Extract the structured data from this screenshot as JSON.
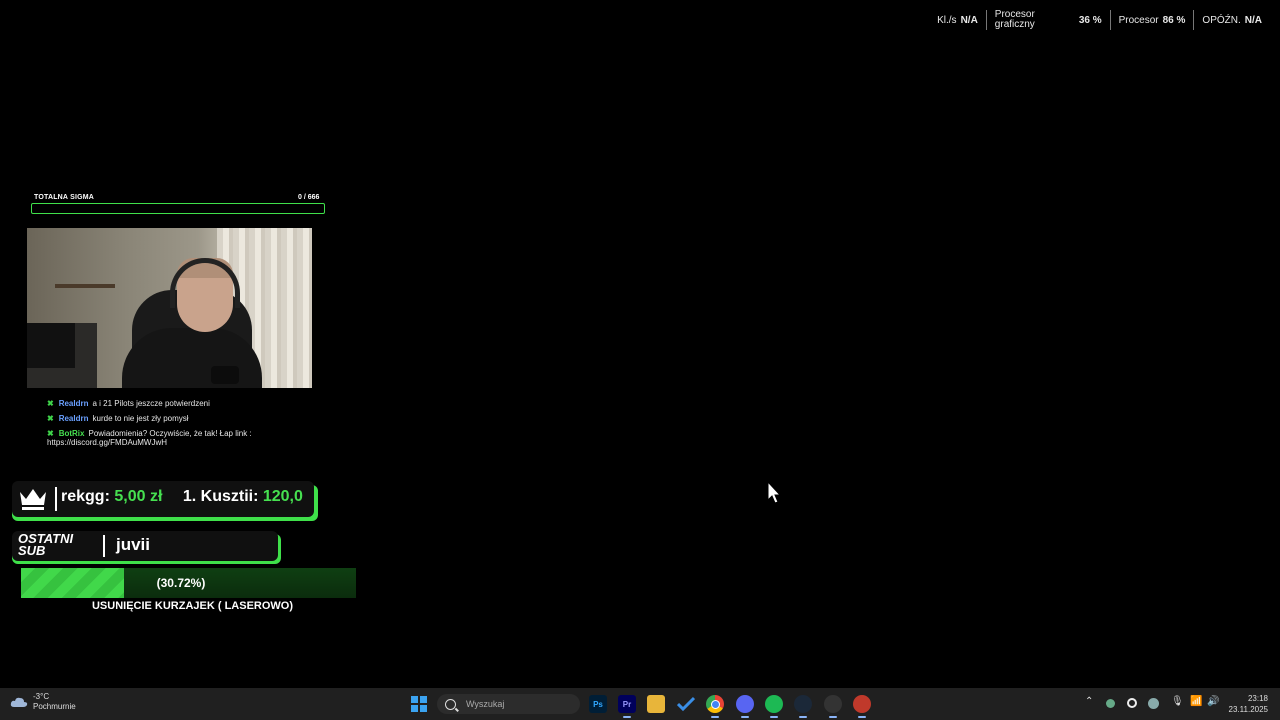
{
  "perf": {
    "fps_label": "Kl./s",
    "fps_value": "N/A",
    "gpu_label_1": "Procesor",
    "gpu_label_2": "graficzny",
    "gpu_value": "36 %",
    "cpu_label": "Procesor",
    "cpu_value": "86 %",
    "latency_label": "OPÓŹN.",
    "latency_value": "N/A"
  },
  "goal": {
    "title": "TOTALNA SIGMA",
    "count": "0  / 666",
    "progress": 0
  },
  "chat": {
    "messages": [
      {
        "badge": "✖",
        "user": "Realdrn",
        "user_color": "#6aa0ff",
        "text": "a i 21 Pilots jeszcze potwierdzeni"
      },
      {
        "badge": "✖",
        "user": "Realdrn",
        "user_color": "#6aa0ff",
        "text": "kurde to nie jest zły pomysł"
      },
      {
        "badge": "✖",
        "user": "BotRix",
        "user_color": "#46e050",
        "text": "Powiadomienia? Oczywiście, że tak! Łap link :",
        "link": "https://discord.gg/FMDAuMWJwH"
      }
    ]
  },
  "donor": {
    "name": "rekgg:",
    "amount": "5,00 zł",
    "top_label": "1. Kusztii:",
    "top_amount": "120,0"
  },
  "last_sub": {
    "label_1": "OSTATNI",
    "label_2": "SUB",
    "name": "juvii"
  },
  "sub_goal": {
    "percent_text": "(30.72%)",
    "fraction": 0.3072,
    "title": "USUNIĘCIE KURZAJEK ( LASEROWO)"
  },
  "taskbar": {
    "weather_temp": "-3°C",
    "weather_desc": "Pochmurnie",
    "search_placeholder": "Wyszukaj",
    "time": "23:18",
    "date": "23.11.2025"
  },
  "colors": {
    "accent_green": "#46e050",
    "chat_blue": "#6aa0ff"
  }
}
